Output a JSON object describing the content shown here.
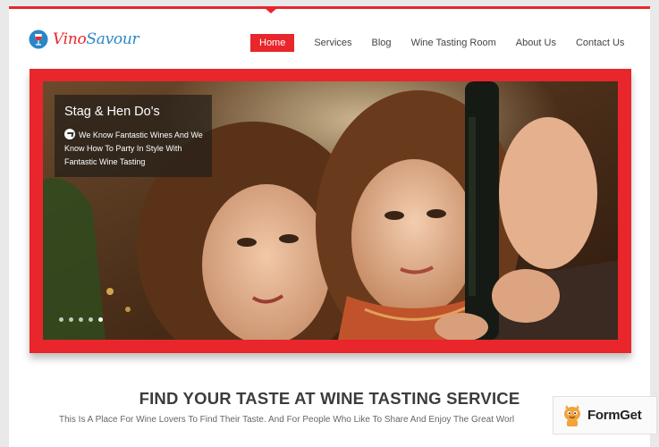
{
  "logo": {
    "part1": "Vino",
    "part2": "Savour"
  },
  "nav": {
    "items": [
      {
        "label": "Home",
        "active": true
      },
      {
        "label": "Services",
        "active": false
      },
      {
        "label": "Blog",
        "active": false
      },
      {
        "label": "Wine Tasting Room",
        "active": false
      },
      {
        "label": "About Us",
        "active": false
      },
      {
        "label": "Contact Us",
        "active": false
      }
    ]
  },
  "slider": {
    "caption_title": "Stag & Hen Do's",
    "caption_text": "We Know Fantastic Wines And We Know How To Party In Style With Fantastic Wine Tasting",
    "slide_count": 5,
    "active_slide": 5
  },
  "intro": {
    "heading": "FIND YOUR TASTE AT WINE TASTING SERVICE",
    "text": "This Is A Place For Wine Lovers To Find Their Taste. And For People Who Like To Share And Enjoy The Great Worl"
  },
  "badge": {
    "label": "FormGet"
  },
  "colors": {
    "accent": "#e8262b",
    "logo_blue": "#2a86c8"
  }
}
